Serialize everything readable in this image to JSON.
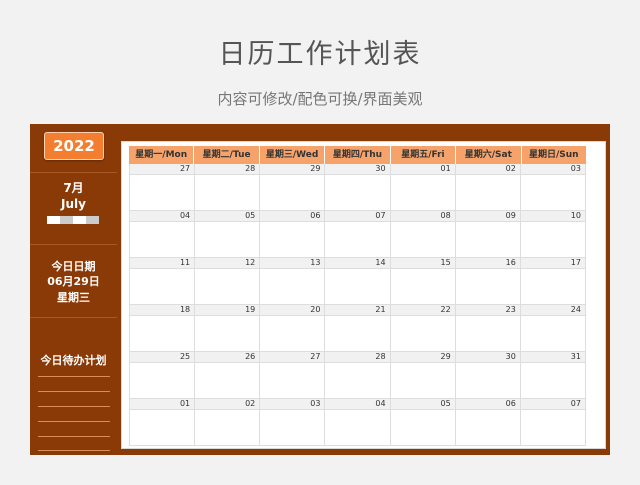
{
  "title": "日历工作计划表",
  "subtitle": "内容可修改/配色可换/界面美观",
  "colors": {
    "frame": "#8a3a06",
    "accent": "#f47e2f",
    "header": "#f5a26b"
  },
  "sidebar": {
    "year": "2022",
    "month_zh": "7月",
    "month_en": "July",
    "today_label": "今日日期",
    "today_date": "06月29日",
    "today_weekday": "星期三",
    "plan_title": "今日待办计划"
  },
  "weekdays": [
    "星期一/Mon",
    "星期二/Tue",
    "星期三/Wed",
    "星期四/Thu",
    "星期五/Fri",
    "星期六/Sat",
    "星期日/Sun"
  ],
  "weeks": [
    [
      "27",
      "28",
      "29",
      "30",
      "01",
      "02",
      "03"
    ],
    [
      "04",
      "05",
      "06",
      "07",
      "08",
      "09",
      "10"
    ],
    [
      "11",
      "12",
      "13",
      "14",
      "15",
      "16",
      "17"
    ],
    [
      "18",
      "19",
      "20",
      "21",
      "22",
      "23",
      "24"
    ],
    [
      "25",
      "26",
      "27",
      "28",
      "29",
      "30",
      "31"
    ],
    [
      "01",
      "02",
      "03",
      "04",
      "05",
      "06",
      "07"
    ]
  ]
}
